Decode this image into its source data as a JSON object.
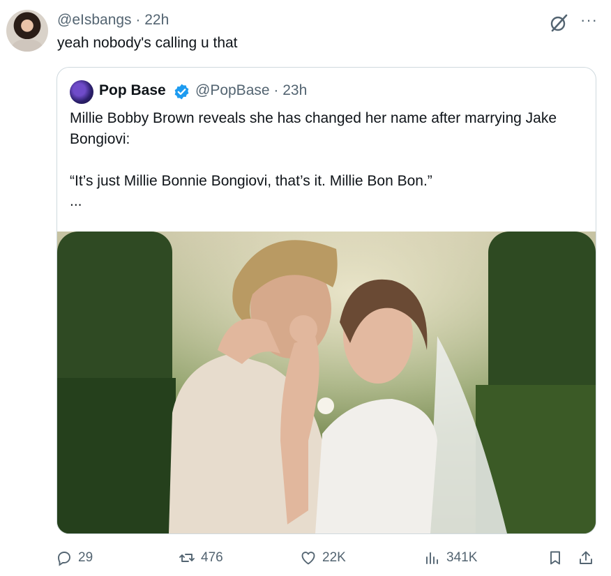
{
  "reply": {
    "handle": "@eIsbangs",
    "separator": "·",
    "time": "22h",
    "text": "yeah nobody's calling u that",
    "more_icon": "more-dots-icon",
    "grok_icon": "grok-icon"
  },
  "quote": {
    "name": "Pop Base",
    "verified_icon": "verified-badge-icon",
    "handle": "@PopBase",
    "separator": "·",
    "time": "23h",
    "line1": "Millie Bobby Brown reveals she has changed her name after marrying Jake Bongiovi:",
    "line2": "“It’s just Millie Bonnie Bongiovi, that’s it. Millie Bon Bon.”",
    "more": "..."
  },
  "actions": {
    "replies": "29",
    "reposts": "476",
    "likes": "22K",
    "views": "341K"
  },
  "colors": {
    "text": "#0f1419",
    "secondary": "#536471",
    "border": "#cfd9de",
    "verified": "#1d9bf0"
  }
}
